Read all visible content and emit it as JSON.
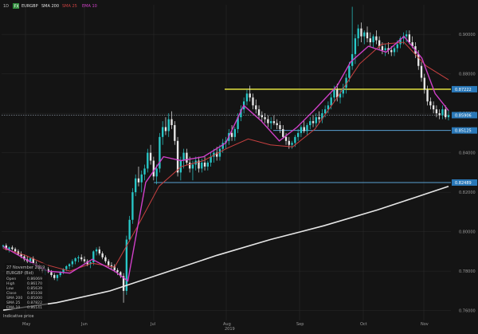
{
  "window": {
    "timeframe": "1D",
    "symbol_badge": "FX",
    "symbol": "EURGBP",
    "indicator_main": "SMA 200",
    "indicator_2": "SMA 25",
    "indicator_3": "EMA 10",
    "footer_label": "Indicative price",
    "year_label": "2019"
  },
  "colors": {
    "background": "#141414",
    "grid": "#2a2a2a",
    "candle_up": "#28c8c8",
    "candle_down": "#e8e8e8",
    "sma200": "#e6e6e6",
    "sma25": "#c84040",
    "ema10": "#d040c8",
    "level_yellow": "#d2d23c",
    "level_blue": "#5aa0d2",
    "label_bg": "#2a78b8"
  },
  "infobox": {
    "date": "27 November 2019",
    "symbol_line": "EURGBP (Bid)",
    "rows": [
      {
        "k": "Open",
        "v": "0.86069"
      },
      {
        "k": "High",
        "v": "0.86170"
      },
      {
        "k": "Low",
        "v": "0.85639"
      },
      {
        "k": "Close",
        "v": "0.85108"
      },
      {
        "k": "SMA 200",
        "v": "0.85000"
      },
      {
        "k": "SMA 25",
        "v": "0.87822"
      },
      {
        "k": "EMA 10",
        "v": "0.86141"
      }
    ]
  },
  "chart_data": {
    "type": "candlestick",
    "x_labels": [
      "May",
      "Jun",
      "Jul",
      "Aug",
      "Sep",
      "Oct",
      "Nov"
    ],
    "y_ticks": [
      "0.90000",
      "0.88000",
      "0.86000",
      "0.84000",
      "0.82000",
      "0.80000",
      "0.78000",
      "0.76000"
    ],
    "y_range": [
      0.755,
      0.915
    ],
    "current_price": {
      "label": "0.85906",
      "value": 0.85906
    },
    "levels": [
      {
        "label": "0.87222",
        "value": 0.8722,
        "color": "yellow"
      },
      {
        "label": "0.85125",
        "value": 0.8513,
        "color": "blue"
      },
      {
        "label": "0.82489",
        "value": 0.8249,
        "color": "blue"
      }
    ],
    "candles": [
      [
        0.7925,
        0.7935,
        0.7915,
        0.793
      ],
      [
        0.793,
        0.794,
        0.7905,
        0.791
      ],
      [
        0.791,
        0.7925,
        0.7895,
        0.792
      ],
      [
        0.792,
        0.793,
        0.7905,
        0.7912
      ],
      [
        0.7912,
        0.792,
        0.7895,
        0.79
      ],
      [
        0.79,
        0.791,
        0.788,
        0.7885
      ],
      [
        0.7885,
        0.79,
        0.7865,
        0.7875
      ],
      [
        0.7875,
        0.7885,
        0.785,
        0.786
      ],
      [
        0.786,
        0.7875,
        0.784,
        0.785
      ],
      [
        0.785,
        0.787,
        0.7835,
        0.7865
      ],
      [
        0.7865,
        0.7875,
        0.783,
        0.784
      ],
      [
        0.784,
        0.785,
        0.7815,
        0.7825
      ],
      [
        0.7825,
        0.7835,
        0.78,
        0.781
      ],
      [
        0.781,
        0.782,
        0.779,
        0.78
      ],
      [
        0.78,
        0.7815,
        0.778,
        0.781
      ],
      [
        0.781,
        0.782,
        0.779,
        0.7795
      ],
      [
        0.7795,
        0.7805,
        0.777,
        0.778
      ],
      [
        0.778,
        0.779,
        0.7755,
        0.7765
      ],
      [
        0.7765,
        0.7785,
        0.775,
        0.778
      ],
      [
        0.778,
        0.78,
        0.777,
        0.7795
      ],
      [
        0.7795,
        0.7815,
        0.7785,
        0.781
      ],
      [
        0.781,
        0.783,
        0.78,
        0.7825
      ],
      [
        0.7825,
        0.784,
        0.781,
        0.7835
      ],
      [
        0.7835,
        0.786,
        0.782,
        0.785
      ],
      [
        0.785,
        0.787,
        0.7835,
        0.7865
      ],
      [
        0.7865,
        0.788,
        0.7845,
        0.787
      ],
      [
        0.787,
        0.7885,
        0.785,
        0.786
      ],
      [
        0.786,
        0.7875,
        0.784,
        0.785
      ],
      [
        0.785,
        0.786,
        0.7825,
        0.7835
      ],
      [
        0.7835,
        0.785,
        0.7815,
        0.7845
      ],
      [
        0.7845,
        0.7905,
        0.783,
        0.79
      ],
      [
        0.79,
        0.792,
        0.788,
        0.791
      ],
      [
        0.791,
        0.7925,
        0.788,
        0.789
      ],
      [
        0.789,
        0.79,
        0.786,
        0.787
      ],
      [
        0.787,
        0.788,
        0.784,
        0.785
      ],
      [
        0.785,
        0.786,
        0.782,
        0.783
      ],
      [
        0.783,
        0.7845,
        0.781,
        0.7825
      ],
      [
        0.7825,
        0.7835,
        0.7795,
        0.7805
      ],
      [
        0.7805,
        0.7815,
        0.778,
        0.7795
      ],
      [
        0.7795,
        0.78,
        0.7765,
        0.7775
      ],
      [
        0.7775,
        0.779,
        0.764,
        0.77
      ],
      [
        0.77,
        0.798,
        0.768,
        0.796
      ],
      [
        0.796,
        0.808,
        0.795,
        0.806
      ],
      [
        0.806,
        0.822,
        0.804,
        0.82
      ],
      [
        0.82,
        0.829,
        0.818,
        0.827
      ],
      [
        0.827,
        0.833,
        0.823,
        0.825
      ],
      [
        0.825,
        0.831,
        0.82,
        0.829
      ],
      [
        0.829,
        0.834,
        0.826,
        0.832
      ],
      [
        0.832,
        0.842,
        0.83,
        0.84
      ],
      [
        0.84,
        0.844,
        0.834,
        0.836
      ],
      [
        0.836,
        0.838,
        0.826,
        0.828
      ],
      [
        0.828,
        0.834,
        0.824,
        0.832
      ],
      [
        0.832,
        0.85,
        0.83,
        0.848
      ],
      [
        0.848,
        0.856,
        0.844,
        0.853
      ],
      [
        0.853,
        0.858,
        0.849,
        0.851
      ],
      [
        0.851,
        0.86,
        0.848,
        0.857
      ],
      [
        0.857,
        0.861,
        0.852,
        0.854
      ],
      [
        0.854,
        0.856,
        0.844,
        0.846
      ],
      [
        0.846,
        0.848,
        0.828,
        0.83
      ],
      [
        0.83,
        0.838,
        0.826,
        0.836
      ],
      [
        0.836,
        0.842,
        0.832,
        0.84
      ],
      [
        0.84,
        0.842,
        0.834,
        0.835
      ],
      [
        0.835,
        0.838,
        0.83,
        0.832
      ],
      [
        0.832,
        0.836,
        0.826,
        0.834
      ],
      [
        0.834,
        0.838,
        0.831,
        0.836
      ],
      [
        0.836,
        0.838,
        0.83,
        0.832
      ],
      [
        0.832,
        0.837,
        0.83,
        0.835
      ],
      [
        0.835,
        0.838,
        0.831,
        0.833
      ],
      [
        0.833,
        0.836,
        0.831,
        0.835
      ],
      [
        0.835,
        0.84,
        0.833,
        0.838
      ],
      [
        0.838,
        0.842,
        0.835,
        0.84
      ],
      [
        0.84,
        0.843,
        0.836,
        0.838
      ],
      [
        0.838,
        0.844,
        0.836,
        0.842
      ],
      [
        0.842,
        0.847,
        0.84,
        0.845
      ],
      [
        0.845,
        0.848,
        0.842,
        0.846
      ],
      [
        0.846,
        0.852,
        0.844,
        0.85
      ],
      [
        0.85,
        0.854,
        0.846,
        0.848
      ],
      [
        0.848,
        0.853,
        0.846,
        0.852
      ],
      [
        0.852,
        0.86,
        0.85,
        0.858
      ],
      [
        0.858,
        0.864,
        0.856,
        0.862
      ],
      [
        0.862,
        0.868,
        0.86,
        0.866
      ],
      [
        0.866,
        0.872,
        0.864,
        0.87
      ],
      [
        0.87,
        0.874,
        0.866,
        0.868
      ],
      [
        0.868,
        0.87,
        0.862,
        0.864
      ],
      [
        0.864,
        0.867,
        0.86,
        0.862
      ],
      [
        0.862,
        0.864,
        0.857,
        0.859
      ],
      [
        0.859,
        0.861,
        0.856,
        0.858
      ],
      [
        0.858,
        0.86,
        0.855,
        0.857
      ],
      [
        0.857,
        0.859,
        0.853,
        0.855
      ],
      [
        0.855,
        0.858,
        0.852,
        0.856
      ],
      [
        0.856,
        0.859,
        0.854,
        0.855
      ],
      [
        0.855,
        0.857,
        0.852,
        0.854
      ],
      [
        0.854,
        0.856,
        0.85,
        0.852
      ],
      [
        0.852,
        0.854,
        0.847,
        0.848
      ],
      [
        0.848,
        0.85,
        0.844,
        0.846
      ],
      [
        0.846,
        0.848,
        0.842,
        0.844
      ],
      [
        0.844,
        0.846,
        0.842,
        0.845
      ],
      [
        0.845,
        0.849,
        0.843,
        0.848
      ],
      [
        0.848,
        0.852,
        0.846,
        0.85
      ],
      [
        0.85,
        0.854,
        0.848,
        0.853
      ],
      [
        0.853,
        0.856,
        0.85,
        0.851
      ],
      [
        0.851,
        0.855,
        0.849,
        0.854
      ],
      [
        0.854,
        0.858,
        0.852,
        0.856
      ],
      [
        0.856,
        0.859,
        0.853,
        0.855
      ],
      [
        0.855,
        0.86,
        0.853,
        0.858
      ],
      [
        0.858,
        0.861,
        0.855,
        0.857
      ],
      [
        0.857,
        0.862,
        0.855,
        0.86
      ],
      [
        0.86,
        0.864,
        0.858,
        0.862
      ],
      [
        0.862,
        0.866,
        0.86,
        0.864
      ],
      [
        0.864,
        0.87,
        0.862,
        0.868
      ],
      [
        0.868,
        0.874,
        0.866,
        0.872
      ],
      [
        0.872,
        0.875,
        0.866,
        0.868
      ],
      [
        0.868,
        0.872,
        0.865,
        0.87
      ],
      [
        0.87,
        0.875,
        0.868,
        0.873
      ],
      [
        0.873,
        0.88,
        0.87,
        0.878
      ],
      [
        0.878,
        0.886,
        0.876,
        0.884
      ],
      [
        0.884,
        0.914,
        0.882,
        0.89
      ],
      [
        0.89,
        0.9,
        0.885,
        0.898
      ],
      [
        0.898,
        0.905,
        0.894,
        0.903
      ],
      [
        0.903,
        0.906,
        0.896,
        0.899
      ],
      [
        0.899,
        0.902,
        0.895,
        0.901
      ],
      [
        0.901,
        0.904,
        0.896,
        0.898
      ],
      [
        0.898,
        0.901,
        0.894,
        0.896
      ],
      [
        0.896,
        0.9,
        0.893,
        0.899
      ],
      [
        0.899,
        0.902,
        0.895,
        0.897
      ],
      [
        0.897,
        0.899,
        0.892,
        0.894
      ],
      [
        0.894,
        0.896,
        0.89,
        0.892
      ],
      [
        0.892,
        0.895,
        0.889,
        0.893
      ],
      [
        0.893,
        0.896,
        0.89,
        0.892
      ],
      [
        0.892,
        0.894,
        0.889,
        0.891
      ],
      [
        0.891,
        0.894,
        0.889,
        0.893
      ],
      [
        0.893,
        0.897,
        0.891,
        0.895
      ],
      [
        0.895,
        0.899,
        0.893,
        0.898
      ],
      [
        0.898,
        0.901,
        0.895,
        0.899
      ],
      [
        0.899,
        0.902,
        0.896,
        0.9
      ],
      [
        0.9,
        0.902,
        0.895,
        0.896
      ],
      [
        0.896,
        0.899,
        0.893,
        0.894
      ],
      [
        0.894,
        0.896,
        0.888,
        0.89
      ],
      [
        0.89,
        0.892,
        0.882,
        0.884
      ],
      [
        0.884,
        0.886,
        0.876,
        0.878
      ],
      [
        0.878,
        0.88,
        0.87,
        0.872
      ],
      [
        0.872,
        0.874,
        0.864,
        0.866
      ],
      [
        0.866,
        0.868,
        0.862,
        0.864
      ],
      [
        0.864,
        0.866,
        0.86,
        0.862
      ],
      [
        0.862,
        0.864,
        0.858,
        0.86
      ],
      [
        0.86,
        0.862,
        0.857,
        0.859
      ],
      [
        0.859,
        0.864,
        0.857,
        0.862
      ],
      [
        0.862,
        0.864,
        0.857,
        0.858
      ],
      [
        0.858,
        0.8617,
        0.8564,
        0.8591
      ]
    ],
    "sma200": [
      [
        0,
        0.7602
      ],
      [
        0.12,
        0.764
      ],
      [
        0.24,
        0.77
      ],
      [
        0.36,
        0.779
      ],
      [
        0.48,
        0.788
      ],
      [
        0.6,
        0.796
      ],
      [
        0.72,
        0.803
      ],
      [
        0.84,
        0.811
      ],
      [
        0.92,
        0.817
      ],
      [
        1.0,
        0.823
      ]
    ],
    "sma25": [
      [
        0,
        0.7915
      ],
      [
        0.05,
        0.788
      ],
      [
        0.1,
        0.783
      ],
      [
        0.15,
        0.78
      ],
      [
        0.2,
        0.784
      ],
      [
        0.25,
        0.782
      ],
      [
        0.3,
        0.802
      ],
      [
        0.35,
        0.823
      ],
      [
        0.4,
        0.833
      ],
      [
        0.45,
        0.836
      ],
      [
        0.5,
        0.842
      ],
      [
        0.55,
        0.847
      ],
      [
        0.6,
        0.844
      ],
      [
        0.65,
        0.843
      ],
      [
        0.7,
        0.852
      ],
      [
        0.75,
        0.868
      ],
      [
        0.8,
        0.885
      ],
      [
        0.85,
        0.895
      ],
      [
        0.9,
        0.896
      ],
      [
        0.95,
        0.884
      ],
      [
        1.0,
        0.877
      ]
    ],
    "ema10": [
      [
        0,
        0.7925
      ],
      [
        0.05,
        0.786
      ],
      [
        0.1,
        0.78
      ],
      [
        0.15,
        0.779
      ],
      [
        0.2,
        0.786
      ],
      [
        0.25,
        0.78
      ],
      [
        0.28,
        0.775
      ],
      [
        0.32,
        0.825
      ],
      [
        0.36,
        0.838
      ],
      [
        0.4,
        0.836
      ],
      [
        0.45,
        0.838
      ],
      [
        0.5,
        0.845
      ],
      [
        0.54,
        0.864
      ],
      [
        0.58,
        0.856
      ],
      [
        0.62,
        0.846
      ],
      [
        0.66,
        0.853
      ],
      [
        0.7,
        0.862
      ],
      [
        0.75,
        0.874
      ],
      [
        0.78,
        0.886
      ],
      [
        0.82,
        0.894
      ],
      [
        0.86,
        0.891
      ],
      [
        0.9,
        0.899
      ],
      [
        0.94,
        0.888
      ],
      [
        0.97,
        0.87
      ],
      [
        1.0,
        0.8614
      ]
    ]
  }
}
